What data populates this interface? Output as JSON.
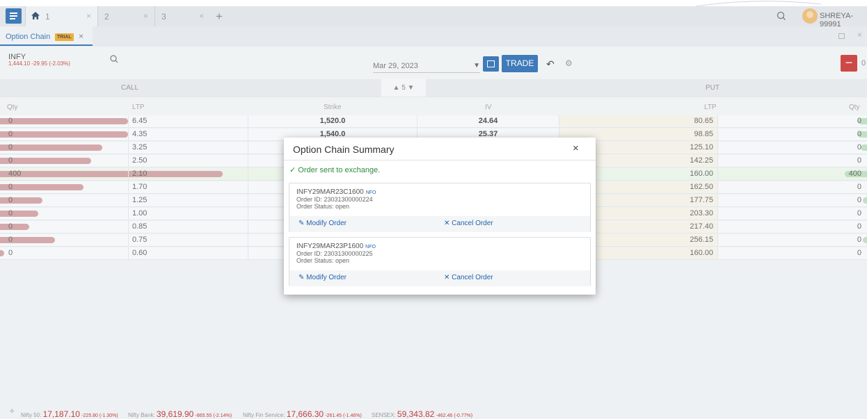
{
  "tabs": [
    {
      "label": "1",
      "close": "×"
    },
    {
      "label": "2",
      "close": "×"
    },
    {
      "label": "3",
      "close": "×"
    }
  ],
  "add_tab": "+",
  "user": {
    "name": "SHREYA-99991"
  },
  "subtab": {
    "label": "Option Chain",
    "badge": "TRIAL",
    "close": "×"
  },
  "window": {
    "close": "×"
  },
  "toolbar": {
    "symbol": "INFY",
    "price": "1,444.10 -29.95 (-2.03%)",
    "expiry": "Mar 29, 2023",
    "trade_label": "TRADE",
    "qty": "0",
    "minus": "−",
    "plus": "+"
  },
  "sections": {
    "call": "CALL",
    "put": "PUT",
    "strike_nav": "▲ 5 ▼"
  },
  "columns": {
    "qty": "Qty",
    "ltp": "LTP",
    "strike": "Strike",
    "iv": "IV",
    "put_ltp": "LTP",
    "put_qty": "Qty"
  },
  "chain": [
    {
      "call_qty": "0",
      "call_bar": 1.0,
      "ltp": "6.45",
      "strike": "1,520.0",
      "iv": "24.64",
      "put_ltp": "80.65",
      "put_qty": "0",
      "put_bar": 0.06,
      "atm": false
    },
    {
      "call_qty": "0",
      "call_bar": 1.0,
      "ltp": "4.35",
      "strike": "1,540.0",
      "iv": "25.37",
      "put_ltp": "98.85",
      "put_qty": "0",
      "put_bar": 0.06,
      "atm": false
    },
    {
      "call_qty": "0",
      "call_bar": 0.8,
      "ltp": "3.25",
      "strike": "",
      "iv": "",
      "put_ltp": "125.10",
      "put_qty": "0",
      "put_bar": 0.04,
      "atm": false
    },
    {
      "call_qty": "0",
      "call_bar": 0.71,
      "ltp": "2.50",
      "strike": "",
      "iv": "",
      "put_ltp": "142.25",
      "put_qty": "0",
      "put_bar": 0.0,
      "atm": false
    },
    {
      "call_qty": "400",
      "call_bar": 1.0,
      "ltp": "2.10",
      "strike": "",
      "iv": "",
      "put_ltp": "160.00",
      "put_qty": "400",
      "put_bar": 0.15,
      "atm": true
    },
    {
      "call_qty": "0",
      "call_bar": 0.65,
      "ltp": "1.70",
      "strike": "",
      "iv": "",
      "put_ltp": "162.50",
      "put_qty": "0",
      "put_bar": 0.0,
      "atm": false
    },
    {
      "call_qty": "0",
      "call_bar": 0.33,
      "ltp": "1.25",
      "strike": "",
      "iv": "",
      "put_ltp": "177.75",
      "put_qty": "0",
      "put_bar": 0.03,
      "atm": false
    },
    {
      "call_qty": "0",
      "call_bar": 0.3,
      "ltp": "1.00",
      "strike": "",
      "iv": "",
      "put_ltp": "203.30",
      "put_qty": "0",
      "put_bar": 0.0,
      "atm": false
    },
    {
      "call_qty": "0",
      "call_bar": 0.23,
      "ltp": "0.85",
      "strike": "",
      "iv": "",
      "put_ltp": "217.40",
      "put_qty": "0",
      "put_bar": 0.0,
      "atm": false
    },
    {
      "call_qty": "0",
      "call_bar": 0.43,
      "ltp": "0.75",
      "strike": "",
      "iv": "",
      "put_ltp": "256.15",
      "put_qty": "0",
      "put_bar": 0.03,
      "atm": false
    },
    {
      "call_qty": "0",
      "call_bar": 0.03,
      "ltp": "0.60",
      "strike": "",
      "iv": "",
      "put_ltp": "160.00",
      "put_qty": "0",
      "put_bar": 0.0,
      "atm": false
    }
  ],
  "modal": {
    "title": "Option Chain Summary",
    "close": "×",
    "success": "✓ Order sent to exchange.",
    "orders": [
      {
        "symbol": "INFY29MAR23C1600",
        "exchange": "NFO",
        "order_id": "Order ID: 23031300000224",
        "status": "Order Status: open",
        "modify": "Modify Order",
        "cancel": "Cancel Order"
      },
      {
        "symbol": "INFY29MAR23P1600",
        "exchange": "NFO",
        "order_id": "Order ID: 23031300000225",
        "status": "Order Status: open",
        "modify": "Modify Order",
        "cancel": "Cancel Order"
      }
    ]
  },
  "ticker": [
    {
      "name": "Nifty 50:",
      "value": "17,187.10",
      "change": "-225.80 (-1.30%)"
    },
    {
      "name": "Nifty Bank:",
      "value": "39,619.90",
      "change": "-865.55 (-2.14%)"
    },
    {
      "name": "Nifty Fin Service:",
      "value": "17,666.30",
      "change": "-261.45 (-1.46%)"
    },
    {
      "name": "SENSEX:",
      "value": "59,343.82",
      "change": "-462.46 (-0.77%)"
    }
  ],
  "colors": {
    "primary": "#1e63ad",
    "negative": "#c62828",
    "positive": "#2e9e3e",
    "call_bar": "#cd9a9e",
    "put_bar": "#b5dcb8"
  }
}
